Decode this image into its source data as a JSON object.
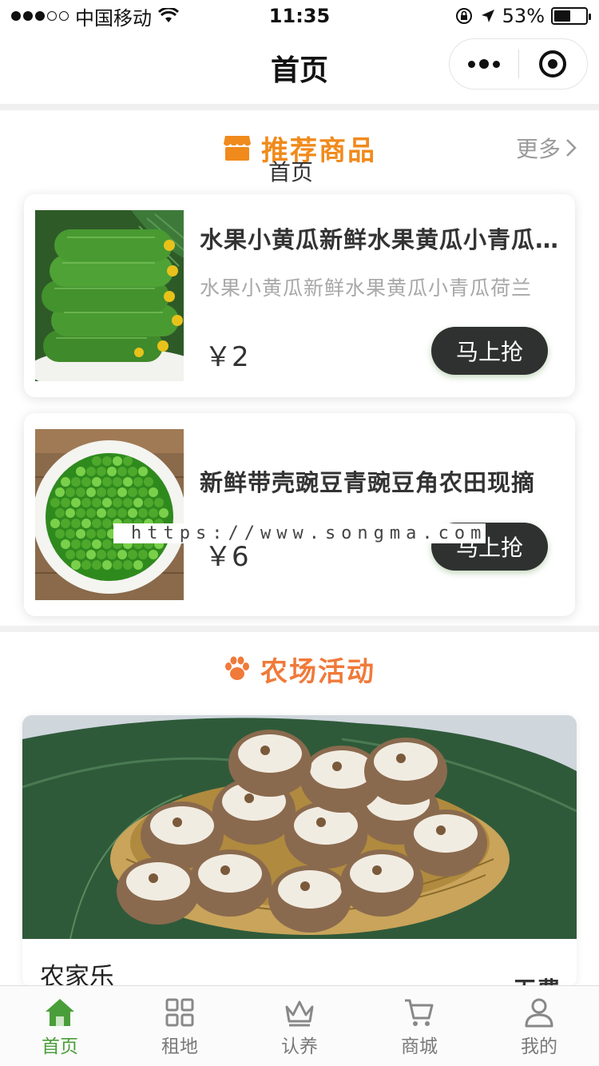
{
  "status_bar": {
    "carrier": "中国移动",
    "time": "11:35",
    "battery": "53%",
    "battery_level": 0.53
  },
  "nav": {
    "title": "首页"
  },
  "recommend": {
    "title": "推荐商品",
    "more": "更多",
    "subtitle": "首页",
    "icon": "shop-icon",
    "accent": "#f08a1c"
  },
  "products": [
    {
      "name": "水果小黄瓜新鲜水果黄瓜小青瓜荷兰",
      "desc": "水果小黄瓜新鲜水果黄瓜小青瓜荷兰",
      "price": "￥2",
      "button": "马上抢",
      "image": "cucumber-image"
    },
    {
      "name": "新鲜带壳豌豆青豌豆角农田现摘",
      "desc": "",
      "price": "￥6",
      "button": "马上抢",
      "image": "peas-image"
    }
  ],
  "watermark": "https://www.songma.com",
  "activity": {
    "title": "农场活动",
    "icon": "paw-icon",
    "card_name": "农家乐",
    "card_tag": "无费",
    "image": "taro-image"
  },
  "tabs": [
    {
      "label": "首页",
      "icon": "home-icon",
      "active": true
    },
    {
      "label": "租地",
      "icon": "grid-icon",
      "active": false
    },
    {
      "label": "认养",
      "icon": "crown-icon",
      "active": false
    },
    {
      "label": "商城",
      "icon": "cart-icon",
      "active": false
    },
    {
      "label": "我的",
      "icon": "user-icon",
      "active": false
    }
  ],
  "colors": {
    "active_tab": "#4a9e3a",
    "button_bg": "#2f3130"
  }
}
